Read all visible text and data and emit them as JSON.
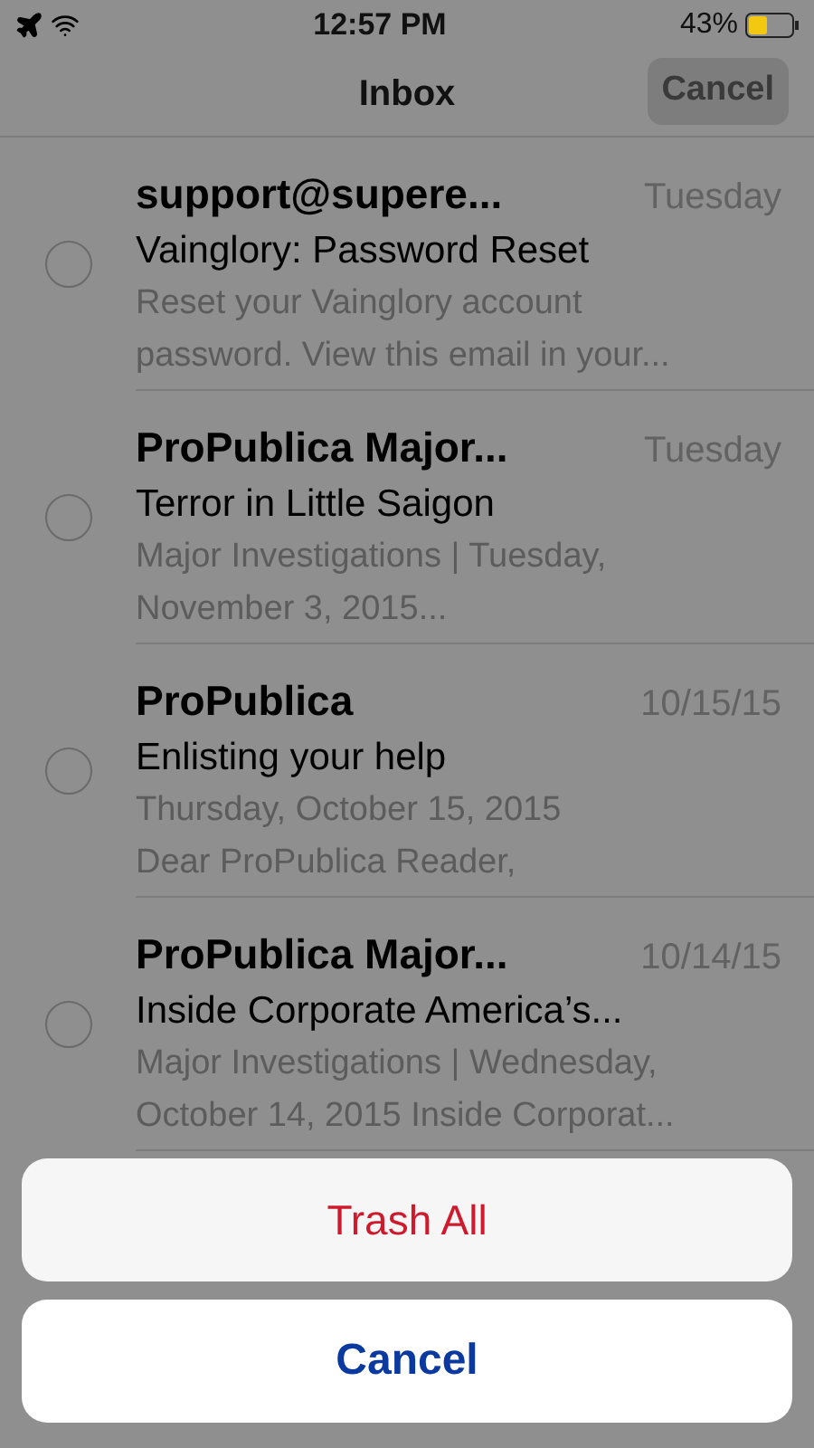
{
  "status_bar": {
    "time": "12:57 PM",
    "battery": "43%"
  },
  "nav": {
    "title": "Inbox",
    "cancel": "Cancel"
  },
  "emails": [
    {
      "sender": "support@supere...",
      "date": "Tuesday",
      "subject": "Vainglory: Password Reset",
      "preview": [
        "Reset your Vainglory account",
        "password. View this email in your..."
      ],
      "selected": false
    },
    {
      "sender": "ProPublica Major...",
      "date": "Tuesday",
      "subject": "Terror in Little Saigon",
      "preview": [
        "Major Investigations | Tuesday,",
        "November 3, 2015..."
      ],
      "selected": false
    },
    {
      "sender": "ProPublica",
      "date": "10/15/15",
      "subject": "Enlisting your help",
      "preview": [
        "Thursday, October 15, 2015",
        "Dear ProPublica Reader,"
      ],
      "selected": false
    },
    {
      "sender": "ProPublica Major...",
      "date": "10/14/15",
      "subject": "Inside Corporate America’s...",
      "preview": [
        "Major Investigations | Wednesday,",
        "October 14, 2015 Inside Corporat..."
      ],
      "selected": false
    }
  ],
  "action_sheet": {
    "actions": [
      {
        "label": "Trash All",
        "kind": "destructive"
      }
    ],
    "cancel": "Cancel"
  }
}
